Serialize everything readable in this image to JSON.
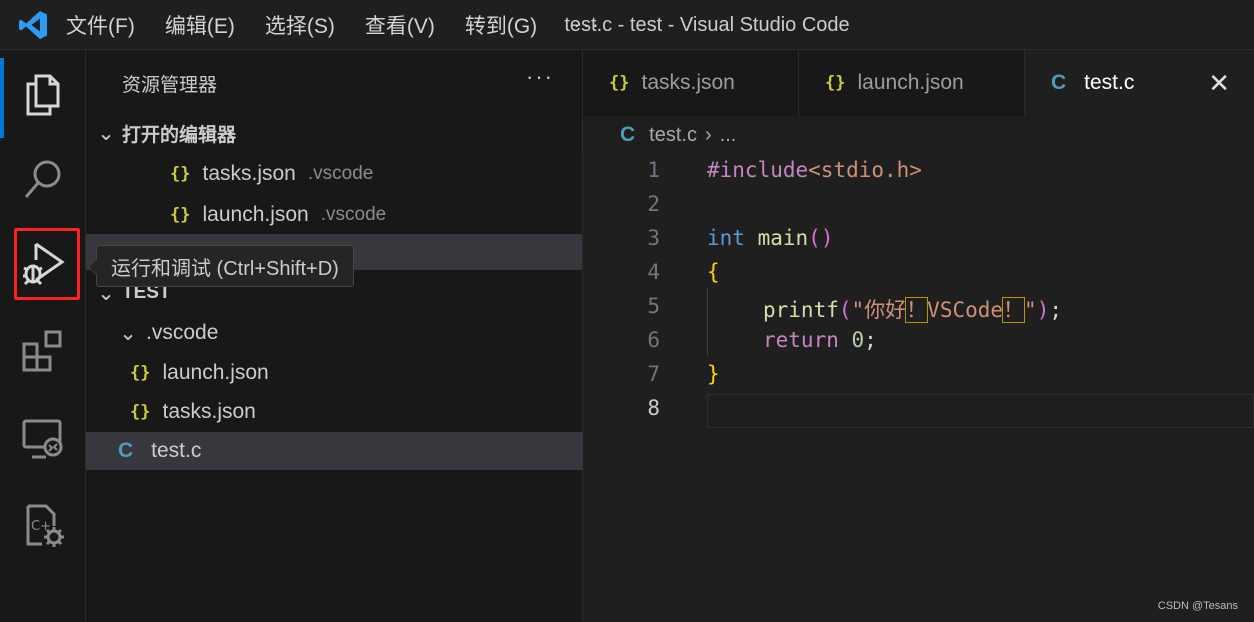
{
  "titlebar": {
    "menu": [
      "文件(F)",
      "编辑(E)",
      "选择(S)",
      "查看(V)",
      "转到(G)"
    ],
    "more": "···",
    "window_title": "test.c - test - Visual Studio Code"
  },
  "activity": {
    "icons": [
      "explorer-icon",
      "search-icon",
      "run-debug-icon",
      "extensions-icon",
      "remote-explorer-icon",
      "cpp-settings-icon"
    ],
    "tooltip": "运行和调试 (Ctrl+Shift+D)",
    "highlight_color": "#ff2020",
    "accent_color": "#0078d4"
  },
  "sidebar": {
    "title": "资源管理器",
    "more": "···",
    "open_editors_title": "打开的编辑器",
    "open_editors": [
      {
        "icon": "{}",
        "name": "tasks.json",
        "desc": ".vscode"
      },
      {
        "icon": "{}",
        "name": "launch.json",
        "desc": ".vscode"
      }
    ],
    "folder_title": "TEST",
    "tree": {
      "folder": ".vscode",
      "files": [
        {
          "icon": "{}",
          "name": "launch.json"
        },
        {
          "icon": "{}",
          "name": "tasks.json"
        }
      ],
      "root_file": {
        "icon": "C",
        "name": "test.c"
      }
    }
  },
  "tabs": [
    {
      "icon": "{}",
      "label": "tasks.json"
    },
    {
      "icon": "{}",
      "label": "launch.json"
    },
    {
      "icon": "C",
      "label": "test.c",
      "close": "✕"
    }
  ],
  "breadcrumb": {
    "icon": "C",
    "file": "test.c",
    "sep": "›",
    "rest": "..."
  },
  "editor": {
    "line_numbers": [
      "1",
      "2",
      "3",
      "4",
      "5",
      "6",
      "7",
      "8"
    ],
    "code": {
      "l1_kw": "#include",
      "l1_hdr": "<stdio.h>",
      "l3_type": "int",
      "l3_fn": "main",
      "l3_paren": "()",
      "l4_brace": "{",
      "l5_fn": "printf",
      "l5_open": "(",
      "l5_q": "\"",
      "l5_s1": "你好",
      "l5_bang1": "！",
      "l5_s2": "VSCode",
      "l5_bang2": "！",
      "l5_q2": "\"",
      "l5_close": ")",
      "l5_semi": ";",
      "l6_kw": "return",
      "l6_num": "0",
      "l6_semi": ";",
      "l7_brace": "}"
    }
  },
  "watermark": "CSDN @Tesans"
}
